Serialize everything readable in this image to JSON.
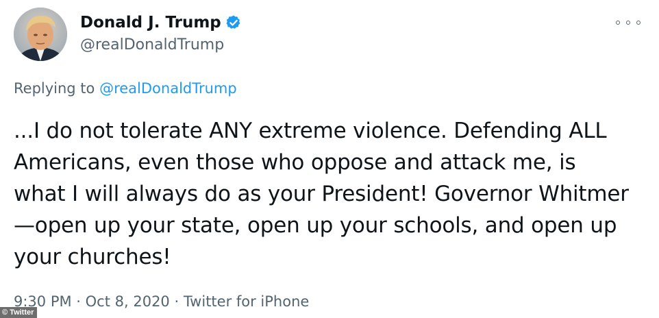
{
  "user": {
    "display_name": "Donald J. Trump",
    "handle": "@realDonaldTrump",
    "verified": true
  },
  "reply": {
    "prefix": "Replying to ",
    "handle": "@realDonaldTrump"
  },
  "tweet": {
    "text": "...I do not tolerate ANY extreme violence. Defending ALL Americans, even those who oppose and attack me, is what I will always do as your President! Governor Whitmer—open up your state, open up your schools, and open up your churches!"
  },
  "meta": {
    "time": "9:30 PM",
    "separator": " · ",
    "date": "Oct 8, 2020",
    "source": "Twitter for iPhone"
  },
  "credit": "© Twitter",
  "colors": {
    "link": "#1d9bf0",
    "secondary_text": "#536471",
    "primary_text": "#0f1419",
    "verified_badge": "#1d9bf0"
  },
  "icons": {
    "verified": "verified-badge-icon",
    "more": "more-options-icon",
    "avatar": "profile-avatar"
  }
}
